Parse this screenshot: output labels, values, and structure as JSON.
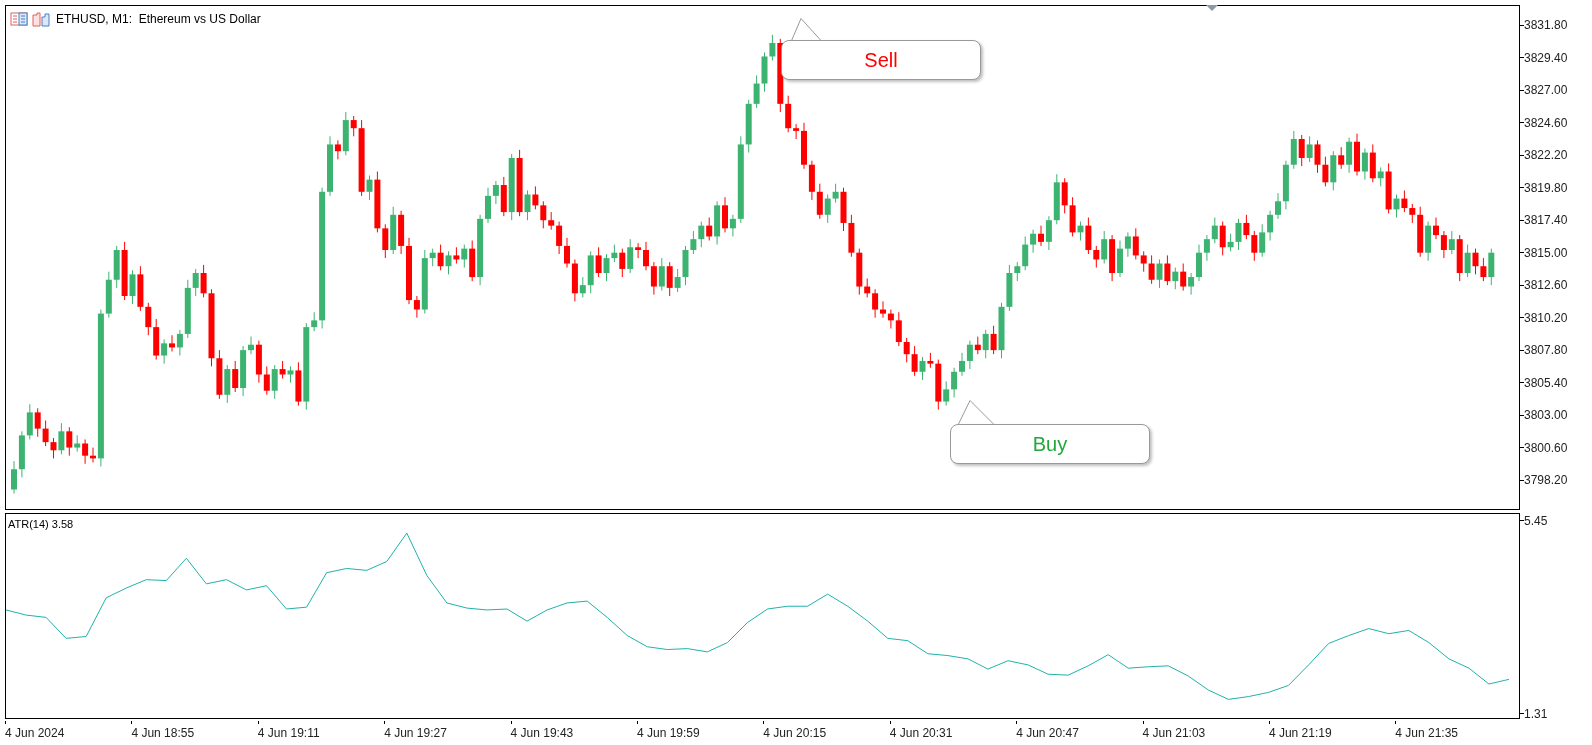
{
  "chart_window": {
    "title": "ETHUSD, M1:  Ethereum vs US Dollar"
  },
  "price_chart": {
    "chart_data": {
      "type": "candlestick",
      "ylim": [
        3796.06,
        3833.23
      ],
      "ohlc": [
        [
          3797.5,
          3799.6,
          3797.2,
          3799.0
        ],
        [
          3799.0,
          3801.8,
          3798.4,
          3801.5
        ],
        [
          3801.5,
          3803.8,
          3801.2,
          3803.2
        ],
        [
          3803.2,
          3803.5,
          3801.4,
          3802.0
        ],
        [
          3802.0,
          3802.6,
          3800.7,
          3801.0
        ],
        [
          3801.0,
          3801.3,
          3799.8,
          3800.4
        ],
        [
          3800.4,
          3802.4,
          3800.1,
          3801.8
        ],
        [
          3801.8,
          3802.1,
          3800.0,
          3800.6
        ],
        [
          3800.6,
          3801.5,
          3800.3,
          3800.9
        ],
        [
          3800.9,
          3801.2,
          3799.4,
          3800.0
        ],
        [
          3800.0,
          3800.6,
          3799.5,
          3799.8
        ],
        [
          3799.8,
          3810.8,
          3799.2,
          3810.5
        ],
        [
          3810.5,
          3813.6,
          3810.2,
          3813.0
        ],
        [
          3813.0,
          3815.5,
          3812.4,
          3815.2
        ],
        [
          3815.2,
          3815.8,
          3811.5,
          3811.8
        ],
        [
          3811.8,
          3813.7,
          3811.2,
          3813.4
        ],
        [
          3813.4,
          3814.0,
          3810.7,
          3811.0
        ],
        [
          3811.0,
          3811.3,
          3808.9,
          3809.5
        ],
        [
          3809.5,
          3810.1,
          3807.1,
          3807.4
        ],
        [
          3807.4,
          3808.6,
          3806.8,
          3808.3
        ],
        [
          3808.3,
          3808.9,
          3807.7,
          3808.0
        ],
        [
          3808.0,
          3809.3,
          3807.4,
          3809.0
        ],
        [
          3809.0,
          3813.0,
          3808.7,
          3812.4
        ],
        [
          3812.4,
          3813.8,
          3811.8,
          3813.5
        ],
        [
          3813.5,
          3814.1,
          3811.7,
          3812.0
        ],
        [
          3812.0,
          3812.3,
          3806.6,
          3807.2
        ],
        [
          3807.2,
          3807.8,
          3804.2,
          3804.5
        ],
        [
          3804.5,
          3806.7,
          3803.9,
          3806.4
        ],
        [
          3806.4,
          3807.0,
          3804.7,
          3805.0
        ],
        [
          3805.0,
          3808.1,
          3804.4,
          3807.8
        ],
        [
          3807.8,
          3808.8,
          3807.5,
          3808.2
        ],
        [
          3808.2,
          3808.5,
          3805.4,
          3806.0
        ],
        [
          3806.0,
          3806.6,
          3804.5,
          3804.8
        ],
        [
          3804.8,
          3806.7,
          3804.2,
          3806.4
        ],
        [
          3806.4,
          3807.0,
          3805.7,
          3806.0
        ],
        [
          3806.0,
          3806.6,
          3805.4,
          3806.3
        ],
        [
          3806.3,
          3806.9,
          3803.7,
          3804.0
        ],
        [
          3804.0,
          3809.8,
          3803.4,
          3809.5
        ],
        [
          3809.5,
          3810.6,
          3809.2,
          3810.0
        ],
        [
          3810.0,
          3819.8,
          3809.4,
          3819.5
        ],
        [
          3819.5,
          3823.6,
          3819.2,
          3823.0
        ],
        [
          3823.0,
          3823.3,
          3821.9,
          3822.5
        ],
        [
          3822.5,
          3825.4,
          3822.2,
          3824.8
        ],
        [
          3824.8,
          3825.1,
          3823.6,
          3824.2
        ],
        [
          3824.2,
          3824.8,
          3819.2,
          3819.5
        ],
        [
          3819.5,
          3820.7,
          3818.9,
          3820.4
        ],
        [
          3820.4,
          3821.0,
          3816.5,
          3816.8
        ],
        [
          3816.8,
          3817.1,
          3814.6,
          3815.2
        ],
        [
          3815.2,
          3818.4,
          3814.9,
          3817.8
        ],
        [
          3817.8,
          3818.1,
          3814.9,
          3815.5
        ],
        [
          3815.5,
          3816.1,
          3811.2,
          3811.5
        ],
        [
          3811.5,
          3811.8,
          3810.2,
          3810.8
        ],
        [
          3810.8,
          3815.2,
          3810.5,
          3814.6
        ],
        [
          3814.6,
          3815.3,
          3814.0,
          3815.0
        ],
        [
          3815.0,
          3815.6,
          3813.7,
          3814.0
        ],
        [
          3814.0,
          3815.1,
          3813.4,
          3814.8
        ],
        [
          3814.8,
          3815.4,
          3814.2,
          3814.5
        ],
        [
          3814.5,
          3815.6,
          3813.9,
          3815.3
        ],
        [
          3815.3,
          3815.9,
          3812.9,
          3813.2
        ],
        [
          3813.2,
          3817.8,
          3812.6,
          3817.5
        ],
        [
          3817.5,
          3819.8,
          3817.2,
          3819.2
        ],
        [
          3819.2,
          3820.3,
          3818.6,
          3820.0
        ],
        [
          3820.0,
          3820.6,
          3817.7,
          3818.0
        ],
        [
          3818.0,
          3822.3,
          3817.4,
          3822.0
        ],
        [
          3822.0,
          3822.6,
          3817.7,
          3818.0
        ],
        [
          3818.0,
          3819.6,
          3817.4,
          3819.3
        ],
        [
          3819.3,
          3819.9,
          3818.2,
          3818.5
        ],
        [
          3818.5,
          3818.8,
          3816.8,
          3817.4
        ],
        [
          3817.4,
          3818.0,
          3816.7,
          3817.0
        ],
        [
          3817.0,
          3817.3,
          3814.9,
          3815.5
        ],
        [
          3815.5,
          3816.1,
          3813.9,
          3814.2
        ],
        [
          3814.2,
          3814.5,
          3811.4,
          3812.0
        ],
        [
          3812.0,
          3813.2,
          3811.7,
          3812.6
        ],
        [
          3812.6,
          3815.1,
          3812.0,
          3814.8
        ],
        [
          3814.8,
          3815.4,
          3813.2,
          3813.5
        ],
        [
          3813.5,
          3814.9,
          3812.9,
          3814.6
        ],
        [
          3814.6,
          3815.6,
          3814.3,
          3815.0
        ],
        [
          3815.0,
          3815.3,
          3813.2,
          3813.8
        ],
        [
          3813.8,
          3816.0,
          3813.5,
          3815.4
        ],
        [
          3815.4,
          3815.7,
          3814.6,
          3815.2
        ],
        [
          3815.2,
          3815.8,
          3813.7,
          3814.0
        ],
        [
          3814.0,
          3814.3,
          3811.9,
          3812.5
        ],
        [
          3812.5,
          3814.6,
          3812.2,
          3814.0
        ],
        [
          3814.0,
          3814.3,
          3811.8,
          3812.4
        ],
        [
          3812.4,
          3813.8,
          3812.1,
          3813.2
        ],
        [
          3813.2,
          3815.5,
          3812.6,
          3815.2
        ],
        [
          3815.2,
          3816.6,
          3814.9,
          3816.0
        ],
        [
          3816.0,
          3817.3,
          3815.4,
          3817.0
        ],
        [
          3817.0,
          3817.6,
          3815.9,
          3816.2
        ],
        [
          3816.2,
          3818.8,
          3815.6,
          3818.5
        ],
        [
          3818.5,
          3819.1,
          3816.5,
          3816.8
        ],
        [
          3816.8,
          3817.8,
          3816.2,
          3817.5
        ],
        [
          3817.5,
          3823.6,
          3817.2,
          3823.0
        ],
        [
          3823.0,
          3826.3,
          3822.4,
          3826.0
        ],
        [
          3826.0,
          3828.1,
          3825.7,
          3827.5
        ],
        [
          3827.5,
          3829.8,
          3826.9,
          3829.5
        ],
        [
          3829.5,
          3831.1,
          3829.2,
          3830.5
        ],
        [
          3830.5,
          3830.8,
          3825.4,
          3826.0
        ],
        [
          3826.0,
          3826.6,
          3823.9,
          3824.2
        ],
        [
          3824.2,
          3824.5,
          3823.4,
          3824.0
        ],
        [
          3824.0,
          3824.6,
          3821.2,
          3821.5
        ],
        [
          3821.5,
          3821.8,
          3818.9,
          3819.5
        ],
        [
          3819.5,
          3820.1,
          3817.5,
          3817.8
        ],
        [
          3817.8,
          3819.3,
          3817.2,
          3819.0
        ],
        [
          3819.0,
          3820.1,
          3818.7,
          3819.5
        ],
        [
          3819.5,
          3819.8,
          3816.6,
          3817.2
        ],
        [
          3817.2,
          3817.8,
          3814.7,
          3815.0
        ],
        [
          3815.0,
          3815.3,
          3811.9,
          3812.5
        ],
        [
          3812.5,
          3813.1,
          3811.7,
          3812.0
        ],
        [
          3812.0,
          3812.3,
          3810.2,
          3810.8
        ],
        [
          3810.8,
          3811.4,
          3810.2,
          3810.5
        ],
        [
          3810.5,
          3810.8,
          3809.4,
          3810.0
        ],
        [
          3810.0,
          3810.6,
          3808.1,
          3808.4
        ],
        [
          3808.4,
          3808.7,
          3806.9,
          3807.5
        ],
        [
          3807.5,
          3808.1,
          3805.9,
          3806.2
        ],
        [
          3806.2,
          3807.3,
          3805.6,
          3807.0
        ],
        [
          3807.0,
          3807.6,
          3806.5,
          3806.8
        ],
        [
          3806.8,
          3807.1,
          3803.4,
          3804.0
        ],
        [
          3804.0,
          3805.5,
          3803.7,
          3804.9
        ],
        [
          3804.9,
          3806.5,
          3804.3,
          3806.2
        ],
        [
          3806.2,
          3807.6,
          3805.9,
          3807.0
        ],
        [
          3807.0,
          3808.5,
          3806.4,
          3808.2
        ],
        [
          3808.2,
          3808.8,
          3807.5,
          3807.8
        ],
        [
          3807.8,
          3809.3,
          3807.2,
          3809.0
        ],
        [
          3809.0,
          3809.6,
          3807.5,
          3807.8
        ],
        [
          3807.8,
          3811.3,
          3807.2,
          3811.0
        ],
        [
          3811.0,
          3814.1,
          3810.7,
          3813.5
        ],
        [
          3813.5,
          3814.3,
          3812.9,
          3814.0
        ],
        [
          3814.0,
          3816.2,
          3813.7,
          3815.6
        ],
        [
          3815.6,
          3816.7,
          3815.0,
          3816.4
        ],
        [
          3816.4,
          3817.0,
          3815.5,
          3815.8
        ],
        [
          3815.8,
          3817.7,
          3815.2,
          3817.4
        ],
        [
          3817.4,
          3820.8,
          3817.1,
          3820.2
        ],
        [
          3820.2,
          3820.5,
          3817.9,
          3818.5
        ],
        [
          3818.5,
          3819.1,
          3816.2,
          3816.5
        ],
        [
          3816.5,
          3817.3,
          3815.9,
          3817.0
        ],
        [
          3817.0,
          3817.6,
          3814.9,
          3815.2
        ],
        [
          3815.2,
          3815.5,
          3813.9,
          3814.5
        ],
        [
          3814.5,
          3816.6,
          3814.2,
          3816.0
        ],
        [
          3816.0,
          3816.3,
          3812.9,
          3813.5
        ],
        [
          3813.5,
          3815.9,
          3813.2,
          3815.3
        ],
        [
          3815.3,
          3816.5,
          3814.7,
          3816.2
        ],
        [
          3816.2,
          3816.8,
          3814.5,
          3814.8
        ],
        [
          3814.8,
          3815.1,
          3813.6,
          3814.2
        ],
        [
          3814.2,
          3814.8,
          3812.7,
          3813.0
        ],
        [
          3813.0,
          3814.5,
          3812.4,
          3814.2
        ],
        [
          3814.2,
          3814.8,
          3812.6,
          3812.9
        ],
        [
          3812.9,
          3813.9,
          3812.3,
          3813.6
        ],
        [
          3813.6,
          3814.2,
          3812.2,
          3812.5
        ],
        [
          3812.5,
          3813.5,
          3811.9,
          3813.2
        ],
        [
          3813.2,
          3815.6,
          3812.9,
          3815.0
        ],
        [
          3815.0,
          3816.3,
          3814.4,
          3816.0
        ],
        [
          3816.0,
          3817.6,
          3815.7,
          3817.0
        ],
        [
          3817.0,
          3817.3,
          3814.8,
          3815.4
        ],
        [
          3815.4,
          3816.4,
          3815.1,
          3815.8
        ],
        [
          3815.8,
          3817.5,
          3815.2,
          3817.2
        ],
        [
          3817.2,
          3817.8,
          3816.0,
          3816.3
        ],
        [
          3816.3,
          3816.6,
          3814.4,
          3815.0
        ],
        [
          3815.0,
          3817.1,
          3814.7,
          3816.5
        ],
        [
          3816.5,
          3818.1,
          3815.9,
          3817.8
        ],
        [
          3817.8,
          3819.4,
          3817.5,
          3818.8
        ],
        [
          3818.8,
          3821.8,
          3818.2,
          3821.5
        ],
        [
          3821.5,
          3824.0,
          3821.2,
          3823.4
        ],
        [
          3823.4,
          3823.7,
          3821.4,
          3822.0
        ],
        [
          3822.0,
          3823.6,
          3821.7,
          3823.0
        ],
        [
          3823.0,
          3823.3,
          3820.9,
          3821.5
        ],
        [
          3821.5,
          3822.1,
          3819.9,
          3820.2
        ],
        [
          3820.2,
          3822.5,
          3819.6,
          3822.2
        ],
        [
          3822.2,
          3822.8,
          3821.2,
          3821.5
        ],
        [
          3821.5,
          3823.5,
          3820.9,
          3823.2
        ],
        [
          3823.2,
          3823.8,
          3820.7,
          3821.0
        ],
        [
          3821.0,
          3822.7,
          3820.4,
          3822.4
        ],
        [
          3822.4,
          3823.0,
          3820.2,
          3820.5
        ],
        [
          3820.5,
          3821.3,
          3819.9,
          3821.0
        ],
        [
          3821.0,
          3821.6,
          3817.9,
          3818.2
        ],
        [
          3818.2,
          3819.3,
          3817.6,
          3819.0
        ],
        [
          3819.0,
          3819.6,
          3818.0,
          3818.3
        ],
        [
          3818.3,
          3818.6,
          3817.2,
          3817.8
        ],
        [
          3817.8,
          3818.4,
          3814.7,
          3815.0
        ],
        [
          3815.0,
          3817.3,
          3814.4,
          3817.0
        ],
        [
          3817.0,
          3817.6,
          3816.0,
          3816.3
        ],
        [
          3816.3,
          3816.6,
          3814.6,
          3815.2
        ],
        [
          3815.2,
          3816.6,
          3814.9,
          3816.0
        ],
        [
          3816.0,
          3816.3,
          3812.9,
          3813.5
        ],
        [
          3813.5,
          3815.6,
          3813.2,
          3815.0
        ],
        [
          3815.0,
          3815.3,
          3813.4,
          3814.0
        ],
        [
          3814.0,
          3814.6,
          3812.9,
          3813.2
        ],
        [
          3813.2,
          3815.3,
          3812.6,
          3815.0
        ]
      ],
      "yticks": [
        {
          "value": 3831.8,
          "label": "3831.80"
        },
        {
          "value": 3829.4,
          "label": "3829.40"
        },
        {
          "value": 3827.0,
          "label": "3827.00"
        },
        {
          "value": 3824.6,
          "label": "3824.60"
        },
        {
          "value": 3822.2,
          "label": "3822.20"
        },
        {
          "value": 3819.8,
          "label": "3819.80"
        },
        {
          "value": 3817.4,
          "label": "3817.40"
        },
        {
          "value": 3815.0,
          "label": "3815.00"
        },
        {
          "value": 3812.6,
          "label": "3812.60"
        },
        {
          "value": 3810.2,
          "label": "3810.20"
        },
        {
          "value": 3807.8,
          "label": "3807.80"
        },
        {
          "value": 3805.4,
          "label": "3805.40"
        },
        {
          "value": 3803.0,
          "label": "3803.00"
        },
        {
          "value": 3800.6,
          "label": "3800.60"
        },
        {
          "value": 3798.2,
          "label": "3798.20"
        }
      ]
    }
  },
  "signals": [
    {
      "kind": "sell",
      "label": "Sell"
    },
    {
      "kind": "buy",
      "label": "Buy"
    }
  ],
  "time_axis": [
    "4 Jun 2024",
    "4 Jun 18:55",
    "4 Jun 19:11",
    "4 Jun 19:27",
    "4 Jun 19:43",
    "4 Jun 19:59",
    "4 Jun 20:15",
    "4 Jun 20:31",
    "4 Jun 20:47",
    "4 Jun 21:03",
    "4 Jun 21:19",
    "4 Jun 21:35"
  ],
  "indicator": {
    "label": "ATR(14) 3.58",
    "chart_data": {
      "type": "line",
      "ylim": [
        1.22,
        5.6
      ],
      "yticks": [
        {
          "value": 5.45,
          "label": "5.45"
        },
        {
          "value": 1.31,
          "label": "1.31"
        }
      ],
      "series": [
        {
          "color": "#20b2aa",
          "values": [
            3.54,
            3.43,
            3.38,
            2.93,
            2.97,
            3.8,
            4.01,
            4.19,
            4.17,
            4.65,
            4.1,
            4.19,
            3.97,
            4.06,
            3.56,
            3.6,
            4.34,
            4.43,
            4.39,
            4.58,
            5.19,
            4.28,
            3.69,
            3.58,
            3.54,
            3.56,
            3.3,
            3.54,
            3.69,
            3.73,
            3.38,
            2.99,
            2.75,
            2.69,
            2.71,
            2.64,
            2.84,
            3.27,
            3.56,
            3.62,
            3.62,
            3.88,
            3.62,
            3.3,
            2.93,
            2.88,
            2.6,
            2.56,
            2.49,
            2.27,
            2.45,
            2.36,
            2.16,
            2.14,
            2.34,
            2.58,
            2.29,
            2.32,
            2.34,
            2.12,
            1.82,
            1.62,
            1.68,
            1.77,
            1.92,
            2.36,
            2.82,
            2.99,
            3.14,
            3.03,
            3.1,
            2.84,
            2.49,
            2.29,
            1.95,
            2.05
          ]
        }
      ]
    }
  }
}
